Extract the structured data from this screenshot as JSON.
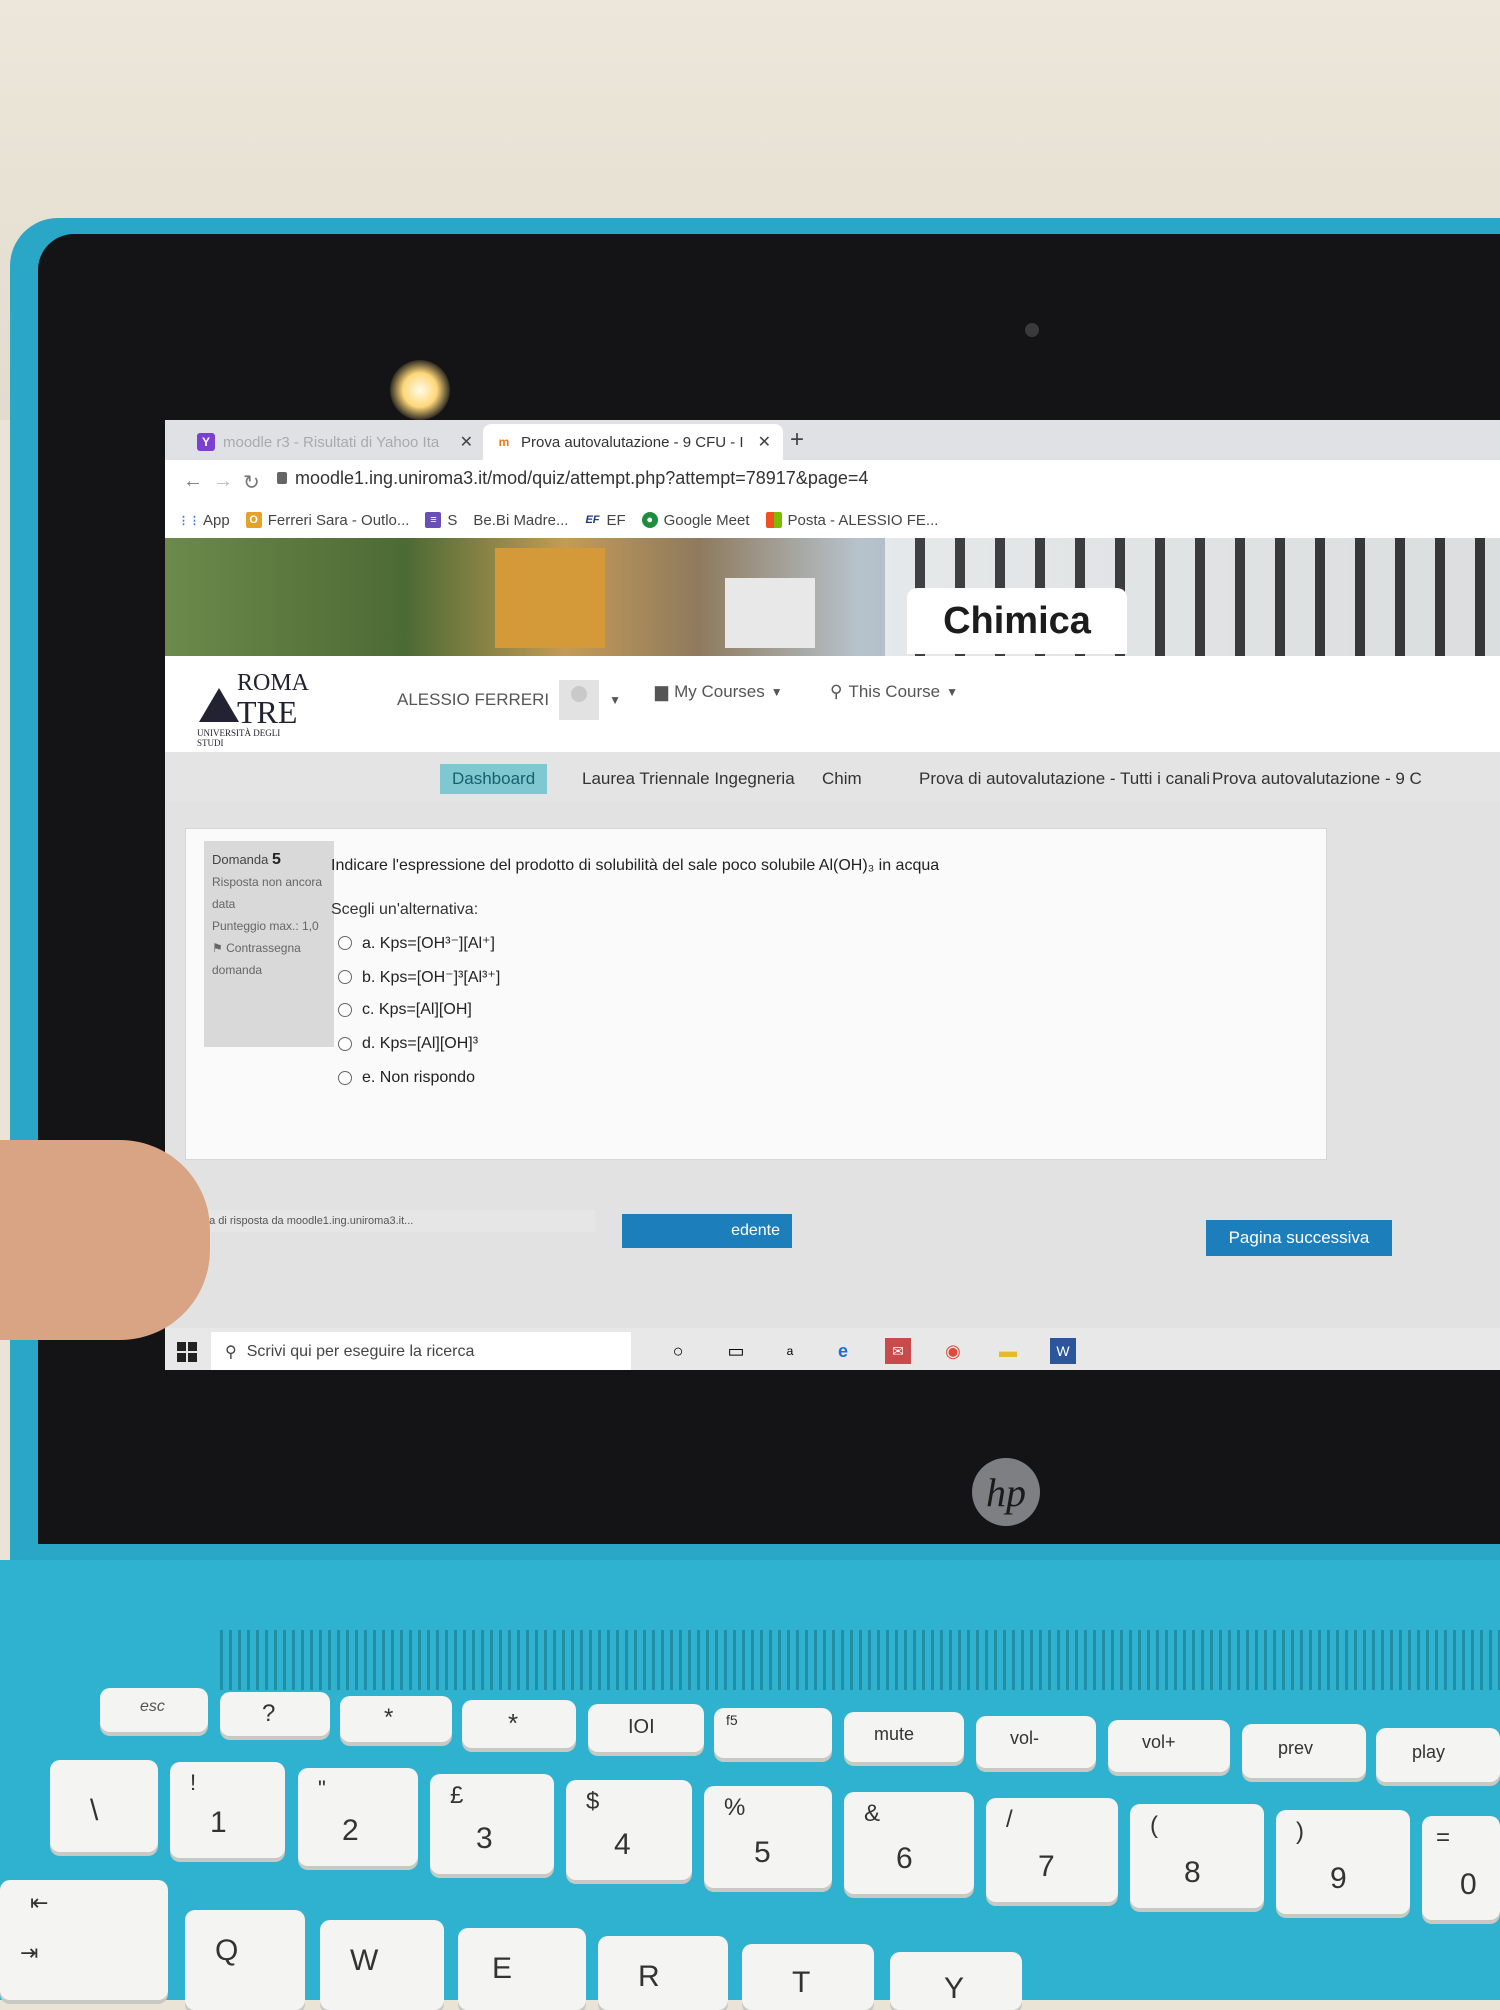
{
  "browser": {
    "tabs": [
      {
        "label": "moodle r3 - Risultati di Yahoo Ita",
        "icon": "yahoo-icon",
        "active": false
      },
      {
        "label": "Prova autovalutazione - 9 CFU - I",
        "icon": "moodle-icon",
        "active": true
      }
    ],
    "new_tab": "+",
    "url": "moodle1.ing.uniroma3.it/mod/quiz/attempt.php?attempt=78917&page=4",
    "bookmarks": [
      {
        "label": "App",
        "icon": "apps-icon"
      },
      {
        "label": "Ferreri Sara - Outlo...",
        "icon": "outlook-icon"
      },
      {
        "label": "S",
        "icon": "list-icon"
      },
      {
        "label": "Be.Bi Madre...",
        "icon": "bookmark-icon"
      },
      {
        "label": "EF",
        "icon": "ef-icon"
      },
      {
        "label": "Google Meet",
        "icon": "meet-icon"
      },
      {
        "label": "Posta - ALESSIO FE...",
        "icon": "microsoft-icon"
      }
    ]
  },
  "banner": {
    "title": "Chimica"
  },
  "header": {
    "logo": {
      "line1": "ROMA",
      "line2": "TRE",
      "line3": "UNIVERSITÀ DEGLI STUDI"
    },
    "user": "ALESSIO FERRERI",
    "menus": [
      "My Courses",
      "This Course"
    ]
  },
  "breadcrumb": [
    "Dashboard",
    "Laurea Triennale Ingegneria",
    "Chim",
    "Prova di autovalutazione - Tutti i canali",
    "Prova autovalutazione - 9 C"
  ],
  "question": {
    "label": "Domanda",
    "number": "5",
    "status": "Risposta non ancora data",
    "max_score": "Punteggio max.: 1,0",
    "flag": "Contrassegna domanda",
    "text": "Indicare l'espressione del prodotto di solubilità del sale poco solubile Al(OH)₃ in acqua",
    "prompt": "Scegli un'alternativa:",
    "options": [
      "a. Kps=[OH³⁻][Al⁺]",
      "b. Kps=[OH⁻]³[Al³⁺]",
      "c. Kps=[Al][OH]",
      "d. Kps=[Al][OH]³",
      "e. Non rispondo"
    ]
  },
  "buttons": {
    "prev": "edente",
    "next": "Pagina successiva"
  },
  "status_bar": "In attesa di risposta da moodle1.ing.uniroma3.it...",
  "taskbar": {
    "search_placeholder": "Scrivi qui per eseguire la ricerca"
  },
  "brand": "hp",
  "keyboard": {
    "fn_row": [
      "esc",
      "?",
      "*",
      "*",
      "IOI",
      "f5",
      "mute",
      "vol-",
      "vol+",
      "prev",
      "play"
    ],
    "num_row": [
      "\\",
      "1",
      "2",
      "3",
      "4",
      "5",
      "6",
      "7",
      "8",
      "9",
      "0"
    ],
    "num_row_shift": [
      "|",
      "!",
      "\"",
      "£",
      "$",
      "%",
      "&",
      "/",
      "(",
      ")",
      "="
    ],
    "letter_row": [
      "Q",
      "W",
      "E",
      "R",
      "T",
      "Y"
    ]
  },
  "colors": {
    "laptop": "#2aa7c6",
    "accent": "#1c7fbc",
    "breadcrumb_active": "#7fc7d1"
  }
}
